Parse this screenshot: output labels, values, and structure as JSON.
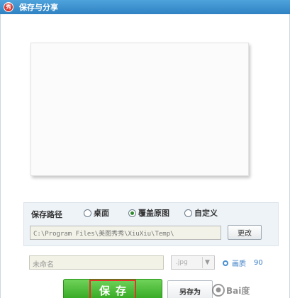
{
  "window": {
    "title": "保存与分享",
    "icon_glyph": "秀"
  },
  "save_path": {
    "label": "保存路径",
    "options": [
      {
        "label": "桌面",
        "selected": false
      },
      {
        "label": "覆盖原图",
        "selected": true
      },
      {
        "label": "自定义",
        "selected": false
      }
    ],
    "path_value": "C:\\Program Files\\美图秀秀\\XiuXiu\\Temp\\",
    "change_label": "更改"
  },
  "file": {
    "name_placeholder": "未命名",
    "format": ".jpg",
    "quality_label": "画质",
    "quality_value": "90"
  },
  "actions": {
    "save_label": "保存",
    "save_as_label": "另存为"
  },
  "watermark": {
    "text": "Bai度"
  },
  "colors": {
    "title_bar": "#3a8fd0",
    "save_button": "#3fb52a",
    "highlight_box": "#e0342c",
    "quality_accent": "#3a7cc4"
  }
}
